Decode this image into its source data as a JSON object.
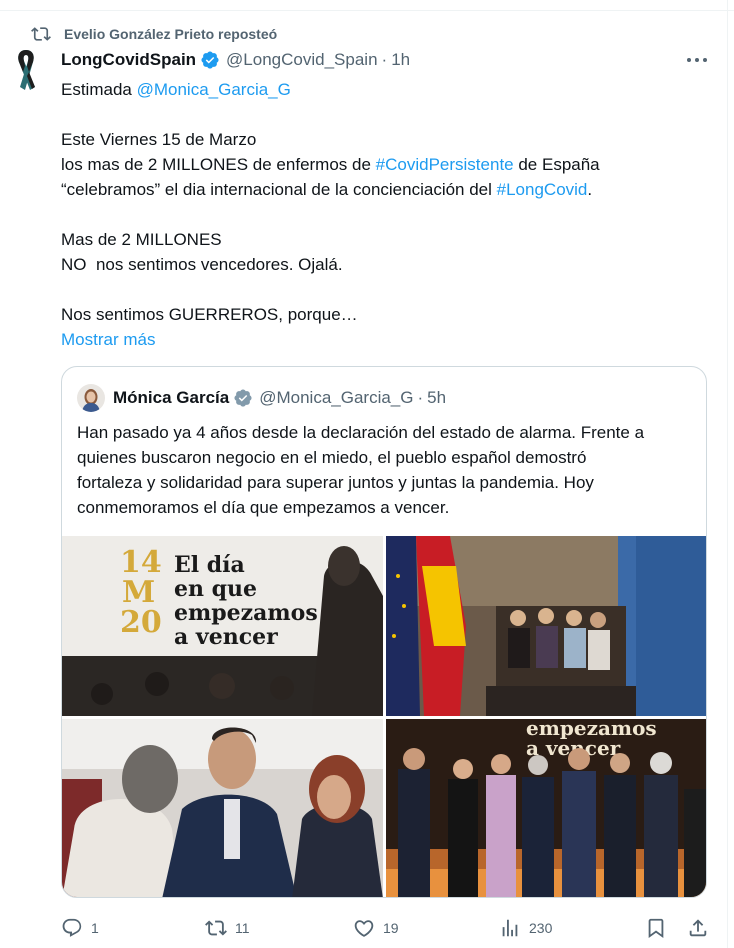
{
  "repost": {
    "icon": "repost-icon",
    "label": "Evelio González Prieto reposteó"
  },
  "tweet": {
    "author_name": "LongCovidSpain",
    "author_handle": "@LongCovid_Spain",
    "time": "1h",
    "lines": {
      "l1": {
        "pre": "Estimada ",
        "mention": "@Monica_Garcia_G"
      },
      "l2": "Este Viernes 15 de Marzo",
      "l3": {
        "pre": "los mas de 2 MILLONES de enfermos de ",
        "tag": "#CovidPersistente",
        "post": " de España"
      },
      "l4": {
        "pre": "“celebramos” el dia internacional de la concienciación del ",
        "tag": "#LongCovid",
        "post": "."
      },
      "l5": "Mas de 2 MILLONES",
      "l6": "NO  nos sentimos vencedores. Ojalá.",
      "l7": "Nos sentimos GUERREROS, porque…"
    },
    "show_more": "Mostrar más"
  },
  "quote": {
    "author_name": "Mónica García",
    "author_handle": "@Monica_Garcia_G",
    "time": "5h",
    "lines": [
      "Han pasado ya 4 años desde la declaración del estado de alarma. Frente a",
      "quienes buscaron negocio en el miedo, el pueblo español demostró",
      "fortaleza y solidaridad para superar juntos y juntas la pandemia. Hoy",
      "conmemoramos el día que empezamos a vencer."
    ],
    "photo1": {
      "num1": "14",
      "num2": "M",
      "num3": "20",
      "t1": "El día",
      "t2": "en que",
      "t3": "empezamos",
      "t4": "a vencer"
    },
    "photo4": {
      "t1": "empezamos",
      "t2": "a vencer"
    }
  },
  "actions": {
    "replies": "1",
    "reposts": "11",
    "likes": "19",
    "views": "230"
  },
  "colors": {
    "link": "#1d9bf0",
    "muted": "#536471",
    "verified": "#1d9bf0",
    "repost_active": "#00ba7c",
    "banner_yellow": "#d4a93a"
  }
}
